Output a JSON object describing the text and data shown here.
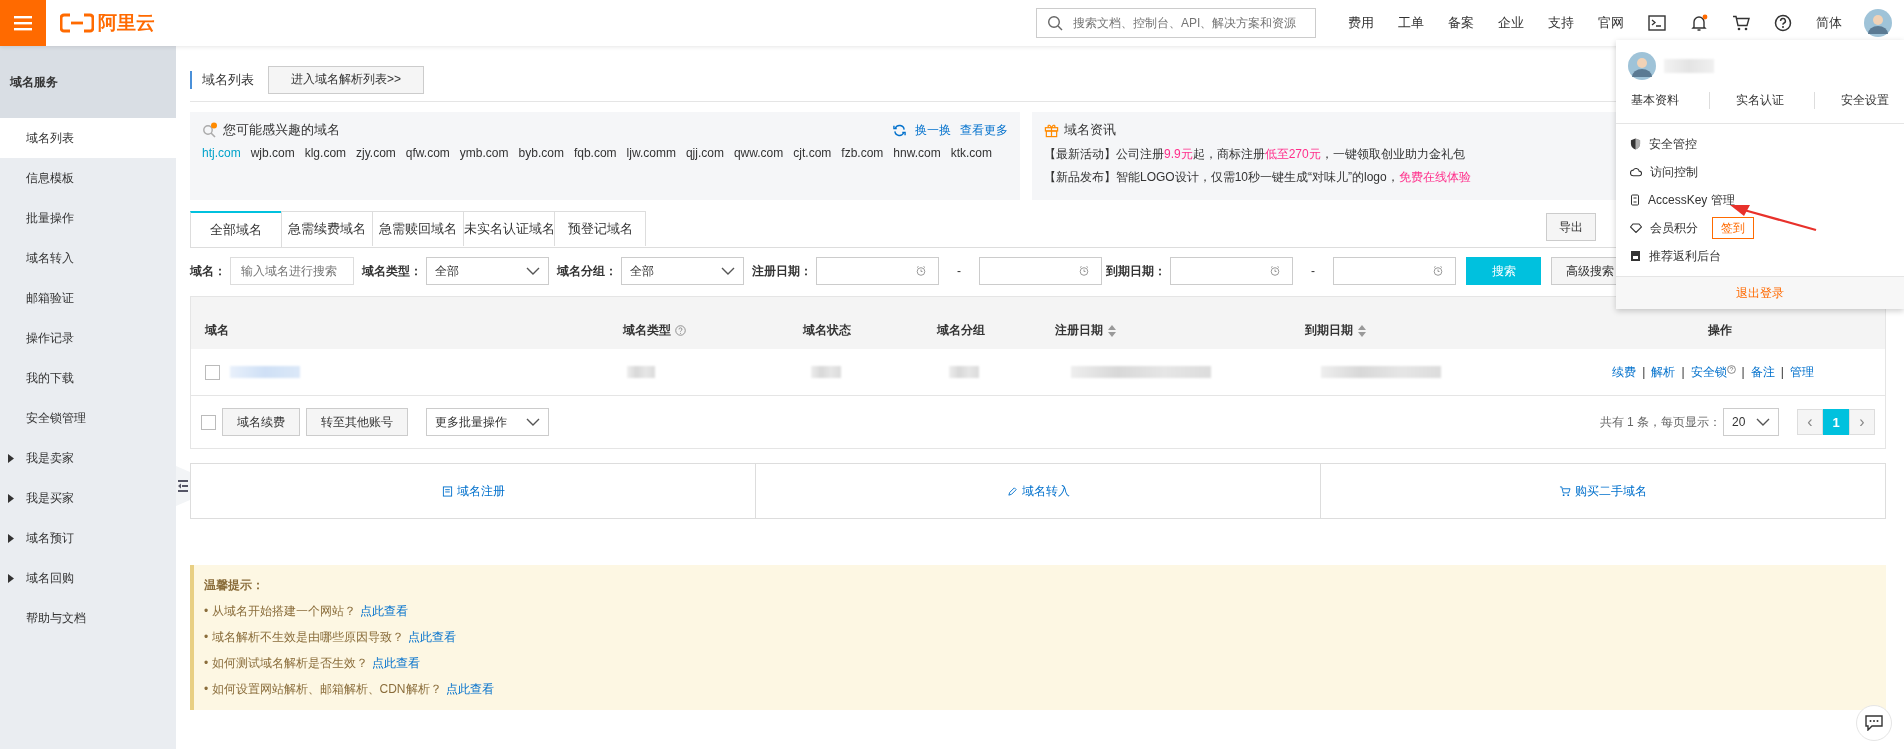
{
  "topbar": {
    "logo_text": "阿里云",
    "search": {
      "placeholder": "搜索文档、控制台、API、解决方案和资源"
    },
    "nav": [
      "费用",
      "工单",
      "备案",
      "企业",
      "支持",
      "官网"
    ],
    "has_unread": true,
    "language": "简体"
  },
  "sidebar": {
    "title": "域名服务",
    "items": [
      {
        "label": "域名列表",
        "kind": "link",
        "selected": true
      },
      {
        "label": "信息模板",
        "kind": "link",
        "selected": false
      },
      {
        "label": "批量操作",
        "kind": "link",
        "selected": false
      },
      {
        "label": "域名转入",
        "kind": "link",
        "selected": false
      },
      {
        "label": "邮箱验证",
        "kind": "link",
        "selected": false
      },
      {
        "label": "操作记录",
        "kind": "link",
        "selected": false
      },
      {
        "label": "我的下载",
        "kind": "link",
        "selected": false
      },
      {
        "label": "安全锁管理",
        "kind": "link",
        "selected": false
      },
      {
        "label": "我是卖家",
        "kind": "group",
        "selected": false
      },
      {
        "label": "我是买家",
        "kind": "group",
        "selected": false
      },
      {
        "label": "域名预订",
        "kind": "group",
        "selected": false
      },
      {
        "label": "域名回购",
        "kind": "group",
        "selected": false
      },
      {
        "label": "帮助与文档",
        "kind": "link",
        "selected": false
      }
    ]
  },
  "page": {
    "title": "域名列表",
    "parse_button": "进入域名解析列表>>"
  },
  "recommend": {
    "title": "您可能感兴趣的域名",
    "refresh": "换一换",
    "more": "查看更多",
    "domains": [
      {
        "name": "htj.com",
        "selected": true
      },
      {
        "name": "wjb.com",
        "selected": false
      },
      {
        "name": "klg.com",
        "selected": false
      },
      {
        "name": "zjy.com",
        "selected": false
      },
      {
        "name": "qfw.com",
        "selected": false
      },
      {
        "name": "ymb.com",
        "selected": false
      },
      {
        "name": "byb.com",
        "selected": false
      },
      {
        "name": "fqb.com",
        "selected": false
      },
      {
        "name": "ljw.comm",
        "selected": false
      },
      {
        "name": "qjj.com",
        "selected": false
      },
      {
        "name": "qww.com",
        "selected": false
      },
      {
        "name": "cjt.com",
        "selected": false
      },
      {
        "name": "fzb.com",
        "selected": false
      },
      {
        "name": "hnw.com",
        "selected": false
      },
      {
        "name": "ktk.com",
        "selected": false
      }
    ]
  },
  "news": {
    "title": "域名资讯",
    "items": [
      [
        {
          "text": "【最新活动】公司注册",
          "highlight": false
        },
        {
          "text": "9.9元",
          "highlight": true
        },
        {
          "text": "起，商标注册",
          "highlight": false
        },
        {
          "text": "低至270元",
          "highlight": true
        },
        {
          "text": "，一键领取创业助力金礼包",
          "highlight": false
        }
      ],
      [
        {
          "text": "【新品发布】智能LOGO设计，仅需10秒一键生成“对味儿”的logo，",
          "highlight": false
        },
        {
          "text": "免费在线体验",
          "highlight": true
        }
      ]
    ]
  },
  "tabs": [
    {
      "label": "全部域名",
      "selected": true
    },
    {
      "label": "急需续费域名",
      "selected": false
    },
    {
      "label": "急需赎回域名",
      "selected": false
    },
    {
      "label": "未实名认证域名",
      "selected": false
    },
    {
      "label": "预登记域名",
      "selected": false
    }
  ],
  "export_button": "导出",
  "filters": {
    "name_label": "域名：",
    "name_placeholder": "输入域名进行搜索",
    "type_label": "域名类型：",
    "type_value": "全部",
    "group_label": "域名分组：",
    "group_value": "全部",
    "reg_label": "注册日期：",
    "exp_label": "到期日期：",
    "range_sep": "-",
    "search_button": "搜索",
    "advanced_button": "高级搜索"
  },
  "table": {
    "columns": [
      {
        "label": "域名",
        "help": false,
        "sortable": false
      },
      {
        "label": "域名类型",
        "help": true,
        "sortable": false
      },
      {
        "label": "域名状态",
        "help": false,
        "sortable": false
      },
      {
        "label": "域名分组",
        "help": false,
        "sortable": false
      },
      {
        "label": "注册日期",
        "help": false,
        "sortable": true
      },
      {
        "label": "到期日期",
        "help": false,
        "sortable": true
      },
      {
        "label": "操作",
        "help": false,
        "sortable": false
      }
    ],
    "rows": [
      {
        "checked": false,
        "separator": "|",
        "actions": [
          {
            "label": "续费",
            "help": false
          },
          {
            "label": "解析",
            "help": false
          },
          {
            "label": "安全锁",
            "help": true
          },
          {
            "label": "备注",
            "help": false
          },
          {
            "label": "管理",
            "help": false
          }
        ]
      }
    ]
  },
  "table_footer": {
    "all_checked": false,
    "batch_buttons": [
      "域名续费",
      "转至其他账号"
    ],
    "batch_select": "更多批量操作",
    "summary": "共有 1 条，每页显示：",
    "page_size": "20",
    "prev": "‹",
    "next": "›",
    "prev_disabled": true,
    "next_disabled": true,
    "pages": [
      {
        "label": "1",
        "selected": true
      }
    ]
  },
  "quick_links": [
    {
      "label": "域名注册",
      "kind": "register"
    },
    {
      "label": "域名转入",
      "kind": "transfer"
    },
    {
      "label": "购买二手域名",
      "kind": "cart"
    }
  ],
  "tips": {
    "title": "温馨提示：",
    "items": [
      {
        "text": "• 从域名开始搭建一个网站？",
        "link": "点此查看"
      },
      {
        "text": "• 域名解析不生效是由哪些原因导致？",
        "link": "点此查看"
      },
      {
        "text": "• 如何测试域名解析是否生效？",
        "link": "点此查看"
      },
      {
        "text": "• 如何设置网站解析、邮箱解析、CDN解析？",
        "link": "点此查看"
      }
    ]
  },
  "user_menu": {
    "links": [
      "基本资料",
      "实名认证",
      "安全设置"
    ],
    "items": [
      {
        "label": "安全管控",
        "kind": "shield"
      },
      {
        "label": "访问控制",
        "kind": "cloud"
      },
      {
        "label": "AccessKey 管理",
        "kind": "key"
      },
      {
        "label": "会员积分",
        "kind": "diamond",
        "button": "签到"
      },
      {
        "label": "推荐返利后台",
        "kind": "book"
      }
    ],
    "logout": "退出登录"
  }
}
